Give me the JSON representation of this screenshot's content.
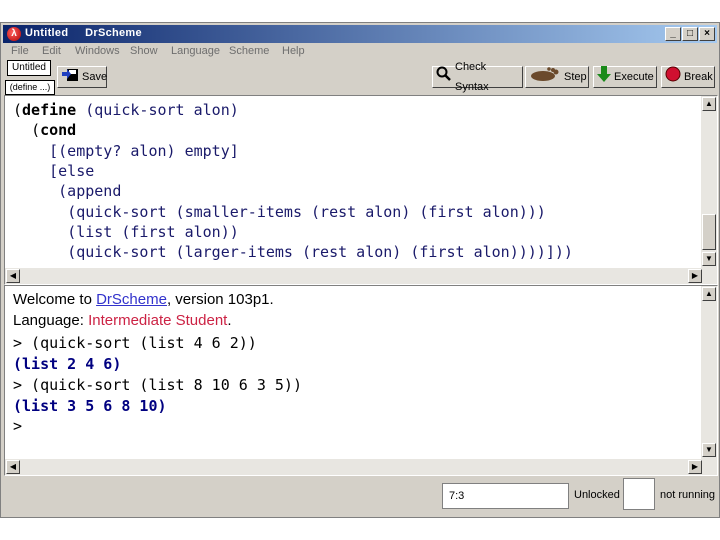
{
  "window": {
    "title": "Untitled     DrScheme",
    "controls": {
      "minimize": "_",
      "maximize": "□",
      "close": "×"
    }
  },
  "menu": [
    "File",
    "Edit",
    "Windows",
    "Show",
    "Language",
    "Scheme",
    "Help"
  ],
  "toolbar": {
    "file_name": "Untitled",
    "define_menu": "(define ...)",
    "save_label": "Save",
    "check_syntax_label": "Check Syntax",
    "step_label": "Step",
    "execute_label": "Execute",
    "break_label": "Break"
  },
  "definitions": {
    "lines": [
      {
        "indent": "",
        "parts": [
          {
            "t": "(",
            "c": "br"
          },
          {
            "t": "define",
            "c": "kw"
          },
          {
            "t": " (quick-sort alon)",
            "c": "sym"
          }
        ]
      },
      {
        "indent": "  ",
        "parts": [
          {
            "t": "(",
            "c": "br"
          },
          {
            "t": "cond",
            "c": "kw"
          }
        ]
      },
      {
        "indent": "    ",
        "parts": [
          {
            "t": "[(empty? alon) empty]",
            "c": "sym"
          }
        ]
      },
      {
        "indent": "    ",
        "parts": [
          {
            "t": "[else",
            "c": "sym"
          }
        ]
      },
      {
        "indent": "     ",
        "parts": [
          {
            "t": "(append",
            "c": "sym"
          }
        ]
      },
      {
        "indent": "      ",
        "parts": [
          {
            "t": "(quick-sort (smaller-items (rest alon) (first alon)))",
            "c": "sym"
          }
        ]
      },
      {
        "indent": "      ",
        "parts": [
          {
            "t": "(list (first alon))",
            "c": "sym"
          }
        ]
      },
      {
        "indent": "      ",
        "parts": [
          {
            "t": "(quick-sort (larger-items (rest alon) (first alon))))]))",
            "c": "sym"
          }
        ]
      }
    ]
  },
  "interactions": {
    "welcome_prefix": "Welcome to ",
    "welcome_link": "DrScheme",
    "welcome_suffix": ", version 103p1.",
    "language_prefix": "Language: ",
    "language_name": "Intermediate Student",
    "language_suffix": ".",
    "entries": [
      {
        "input": "> (quick-sort (list 4 6 2))",
        "output": "(list 2 4 6)"
      },
      {
        "input": "> (quick-sort (list 8 10 6 3 5))",
        "output": "(list 3 5 6 8 10)"
      }
    ],
    "final_prompt": ">"
  },
  "status": {
    "position": "7:3",
    "lock": "Unlocked",
    "running": "not running"
  },
  "colors": {
    "link": "#3333cc",
    "language": "#cc2244",
    "output": "#000080",
    "code": "#1a1a6a"
  }
}
